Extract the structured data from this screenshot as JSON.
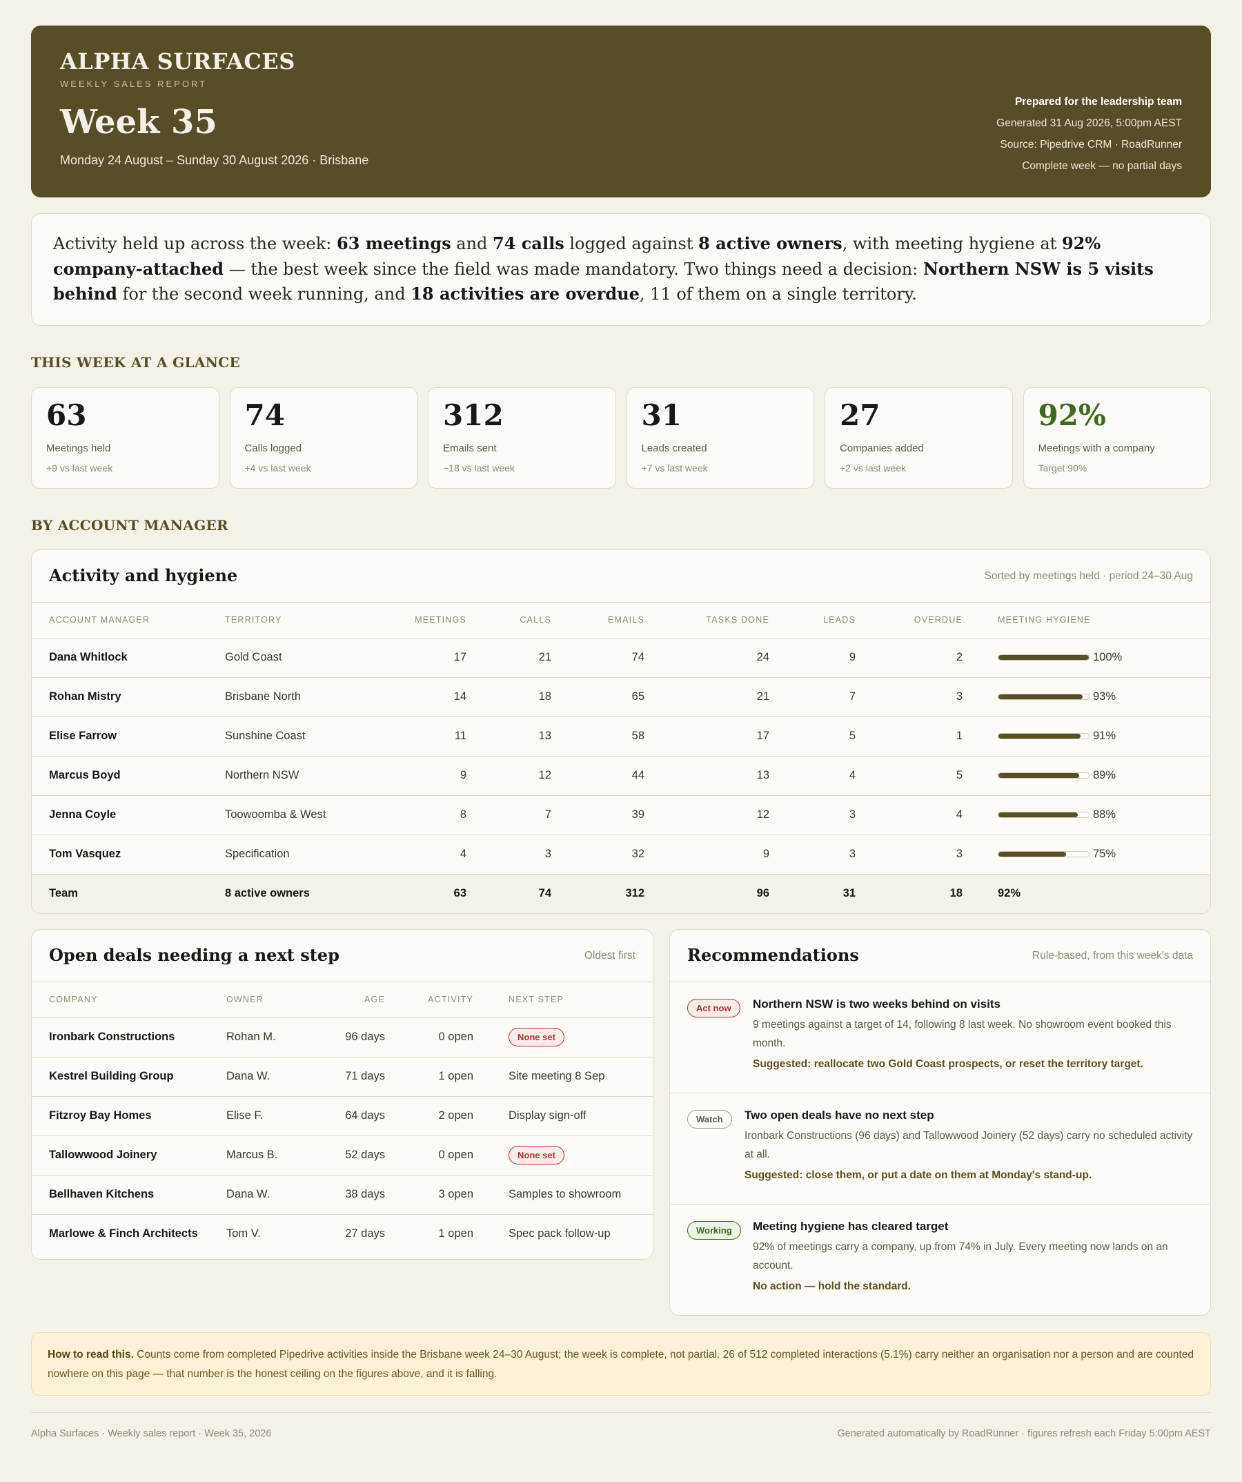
{
  "header": {
    "brand": "ALPHA SURFACES",
    "subtitle": "WEEKLY SALES REPORT",
    "week": "Week 35",
    "dates": "Monday 24 August – Sunday 30 August 2026 · Brisbane",
    "prepared": "Prepared for the leadership team",
    "generated": "Generated 31 Aug 2026, 5:00pm AEST",
    "source": "Source: Pipedrive CRM · RoadRunner",
    "complete": "Complete week — no partial days"
  },
  "summary": {
    "p1": "Activity held up across the week: ",
    "b1": "63 meetings",
    "p2": " and ",
    "b2": "74 calls",
    "p3": " logged against ",
    "b3": "8 active owners",
    "p4": ", with meeting hygiene at ",
    "b4": "92% company-attached",
    "p5": " — the best week since the field was made mandatory. Two things need a decision: ",
    "b5": "Northern NSW is 5 visits behind",
    "p6": " for the second week running, and ",
    "b6": "18 activities are overdue",
    "p7": ", 11 of them on a single territory."
  },
  "sections": {
    "glance": "THIS WEEK AT A GLANCE",
    "by_manager": "BY ACCOUNT MANAGER"
  },
  "kpis": [
    {
      "value": "63",
      "label": "Meetings held",
      "delta": "+9 vs last week"
    },
    {
      "value": "74",
      "label": "Calls logged",
      "delta": "+4 vs last week"
    },
    {
      "value": "312",
      "label": "Emails sent",
      "delta": "−18 vs last week"
    },
    {
      "value": "31",
      "label": "Leads created",
      "delta": "+7 vs last week"
    },
    {
      "value": "27",
      "label": "Companies added",
      "delta": "+2 vs last week"
    },
    {
      "value": "92%",
      "label": "Meetings with a company",
      "delta": "Target 90%",
      "accent": "#3f6a1e"
    }
  ],
  "activity": {
    "title": "Activity and hygiene",
    "note": "Sorted by meetings held · period 24–30 Aug",
    "columns": [
      "ACCOUNT MANAGER",
      "TERRITORY",
      "MEETINGS",
      "CALLS",
      "EMAILS",
      "TASKS DONE",
      "LEADS",
      "OVERDUE",
      "MEETING HYGIENE"
    ],
    "rows": [
      {
        "name": "Dana Whitlock",
        "territory": "Gold Coast",
        "meetings": "17",
        "calls": "21",
        "emails": "74",
        "tasks": "24",
        "leads": "9",
        "overdue": "2",
        "hygiene": "100%",
        "hygiene_value": 1.0
      },
      {
        "name": "Rohan Mistry",
        "territory": "Brisbane North",
        "meetings": "14",
        "calls": "18",
        "emails": "65",
        "tasks": "21",
        "leads": "7",
        "overdue": "3",
        "hygiene": "93%",
        "hygiene_value": 0.93
      },
      {
        "name": "Elise Farrow",
        "territory": "Sunshine Coast",
        "meetings": "11",
        "calls": "13",
        "emails": "58",
        "tasks": "17",
        "leads": "5",
        "overdue": "1",
        "hygiene": "91%",
        "hygiene_value": 0.91
      },
      {
        "name": "Marcus Boyd",
        "territory": "Northern NSW",
        "meetings": "9",
        "calls": "12",
        "emails": "44",
        "tasks": "13",
        "leads": "4",
        "overdue": "5",
        "hygiene": "89%",
        "hygiene_value": 0.89
      },
      {
        "name": "Jenna Coyle",
        "territory": "Toowoomba & West",
        "meetings": "8",
        "calls": "7",
        "emails": "39",
        "tasks": "12",
        "leads": "3",
        "overdue": "4",
        "hygiene": "88%",
        "hygiene_value": 0.88
      },
      {
        "name": "Tom Vasquez",
        "territory": "Specification",
        "meetings": "4",
        "calls": "3",
        "emails": "32",
        "tasks": "9",
        "leads": "3",
        "overdue": "3",
        "hygiene": "75%",
        "hygiene_value": 0.75
      }
    ],
    "team": {
      "name": "Team",
      "territory": "8 active owners",
      "meetings": "63",
      "calls": "74",
      "emails": "312",
      "tasks": "96",
      "leads": "31",
      "overdue": "18",
      "hygiene": "92%"
    }
  },
  "deals": {
    "title": "Open deals needing a next step",
    "note": "Oldest first",
    "columns": [
      "COMPANY",
      "OWNER",
      "AGE",
      "ACTIVITY",
      "NEXT STEP"
    ],
    "rows": [
      {
        "company": "Ironbark Constructions",
        "owner": "Rohan M.",
        "age": "96 days",
        "activity": "0 open",
        "next": "None set",
        "none": true
      },
      {
        "company": "Kestrel Building Group",
        "owner": "Dana W.",
        "age": "71 days",
        "activity": "1 open",
        "next": "Site meeting 8 Sep",
        "none": false
      },
      {
        "company": "Fitzroy Bay Homes",
        "owner": "Elise F.",
        "age": "64 days",
        "activity": "2 open",
        "next": "Display sign-off",
        "none": false
      },
      {
        "company": "Tallowwood Joinery",
        "owner": "Marcus B.",
        "age": "52 days",
        "activity": "0 open",
        "next": "None set",
        "none": true
      },
      {
        "company": "Bellhaven Kitchens",
        "owner": "Dana W.",
        "age": "38 days",
        "activity": "3 open",
        "next": "Samples to showroom",
        "none": false
      },
      {
        "company": "Marlowe & Finch Architects",
        "owner": "Tom V.",
        "age": "27 days",
        "activity": "1 open",
        "next": "Spec pack follow-up",
        "none": false
      }
    ]
  },
  "recommendations": {
    "title": "Recommendations",
    "note": "Rule-based, from this week's data",
    "items": [
      {
        "tag": "Act now",
        "title": "Northern NSW is two weeks behind on visits",
        "desc": "9 meetings against a target of 14, following 8 last week. No showroom event booked this month.",
        "suggestion": "Suggested: reallocate two Gold Coast prospects, or reset the territory target."
      },
      {
        "tag": "Watch",
        "title": "Two open deals have no next step",
        "desc": "Ironbark Constructions (96 days) and Tallowwood Joinery (52 days) carry no scheduled activity at all.",
        "suggestion": "Suggested: close them, or put a date on them at Monday's stand-up."
      },
      {
        "tag": "Working",
        "title": "Meeting hygiene has cleared target",
        "desc": "92% of meetings carry a company, up from 74% in July. Every meeting now lands on an account.",
        "suggestion": "No action — hold the standard."
      }
    ]
  },
  "note": {
    "lead": "How to read this.",
    "text": " Counts come from completed Pipedrive activities inside the Brisbane week 24–30 August; the week is complete, not partial. 26 of 512 completed interactions (5.1%) carry neither an organisation nor a person and are counted nowhere on this page — that number is the honest ceiling on the figures above, and it is falling."
  },
  "footer": {
    "left": "Alpha Surfaces · Weekly sales report · Week 35, 2026",
    "right": "Generated automatically by RoadRunner · figures refresh each Friday 5:00pm AEST"
  }
}
